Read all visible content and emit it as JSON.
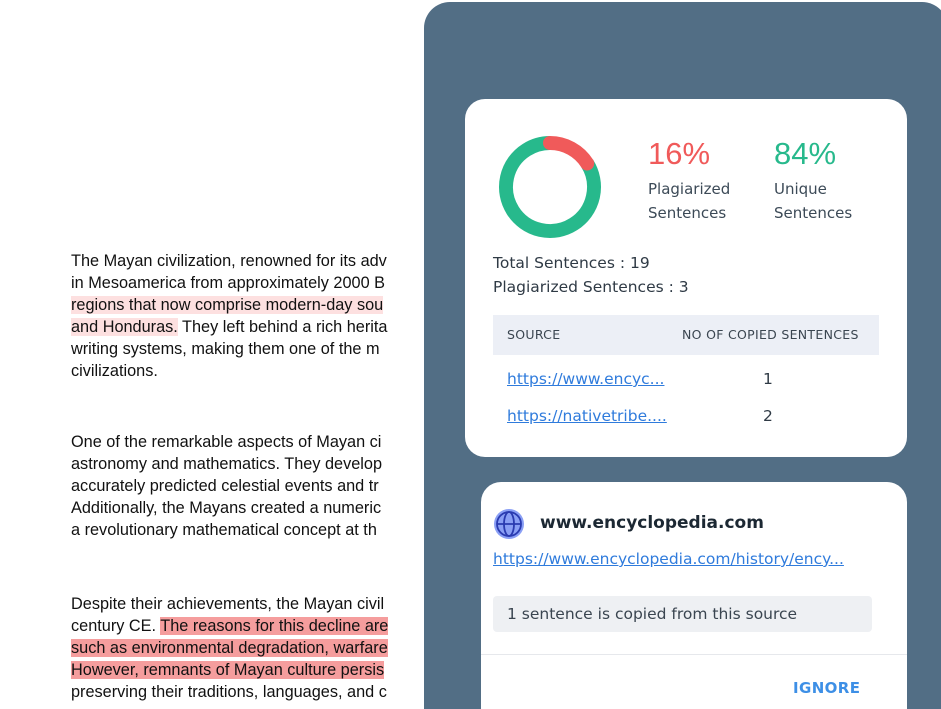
{
  "document": {
    "paragraphs": [
      {
        "lines": [
          [
            {
              "text": "The Mayan civilization, renowned for its adv",
              "hl": ""
            }
          ],
          [
            {
              "text": "in Mesoamerica from approximately 2000 B",
              "hl": ""
            }
          ],
          [
            {
              "text": "regions that now comprise modern-day sou",
              "hl": "light"
            }
          ],
          [
            {
              "text": "and Honduras.",
              "hl": "light"
            },
            {
              "text": " They left behind a rich herita",
              "hl": ""
            }
          ],
          [
            {
              "text": "writing systems, making them one of the m",
              "hl": ""
            }
          ],
          [
            {
              "text": "civilizations.",
              "hl": ""
            }
          ]
        ]
      },
      {
        "lines": [
          [
            {
              "text": "One of the remarkable aspects of Mayan ci",
              "hl": ""
            }
          ],
          [
            {
              "text": "astronomy and mathematics. They develop",
              "hl": ""
            }
          ],
          [
            {
              "text": "accurately predicted celestial events and tr",
              "hl": ""
            }
          ],
          [
            {
              "text": "Additionally, the Mayans created a numeric",
              "hl": ""
            }
          ],
          [
            {
              "text": "a revolutionary mathematical concept at th",
              "hl": ""
            }
          ]
        ]
      },
      {
        "lines": [
          [
            {
              "text": "Despite their achievements, the Mayan civil",
              "hl": ""
            }
          ],
          [
            {
              "text": "century CE. ",
              "hl": ""
            },
            {
              "text": "The reasons for this decline are",
              "hl": "dark"
            }
          ],
          [
            {
              "text": "such as environmental degradation, warfare",
              "hl": "dark"
            }
          ],
          [
            {
              "text": "However, remnants of Mayan culture persis",
              "hl": "dark"
            }
          ],
          [
            {
              "text": "preserving their traditions, languages, and c",
              "hl": ""
            }
          ]
        ]
      }
    ]
  },
  "summary": {
    "plagiarized_pct": "16%",
    "plagiarized_label_1": "Plagiarized",
    "plagiarized_label_2": "Sentences",
    "unique_pct": "84%",
    "unique_label_1": "Unique",
    "unique_label_2": "Sentences",
    "plagiarized_fraction": 0.16,
    "total_sentences": "Total Sentences : 19",
    "plagiarized_sentences": "Plagiarized Sentences : 3",
    "colors": {
      "plagiarized": "#f05a5a",
      "unique": "#27b98c"
    }
  },
  "sources_table": {
    "header_source": "SOURCE",
    "header_count": "NO OF COPIED SENTENCES",
    "rows": [
      {
        "link": "https://www.encyc...",
        "count": "1"
      },
      {
        "link": "https://nativetribe....",
        "count": "2"
      }
    ]
  },
  "source_detail": {
    "icon": "globe-icon",
    "site": "www.encyclopedia.com",
    "url": "https://www.encyclopedia.com/history/ency...",
    "copied_text": "1 sentence is copied from this source",
    "ignore_label": "IGNORE"
  }
}
